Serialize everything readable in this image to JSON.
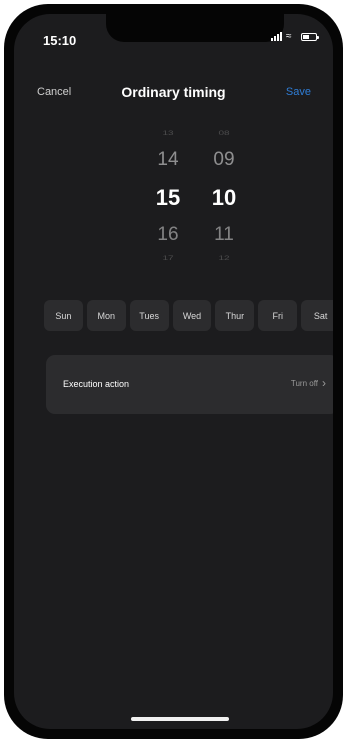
{
  "status_bar": {
    "time": "15:10"
  },
  "header": {
    "cancel": "Cancel",
    "title": "Ordinary timing",
    "save": "Save"
  },
  "picker": {
    "hours": [
      "13",
      "14",
      "15",
      "16",
      "17"
    ],
    "minutes": [
      "08",
      "09",
      "10",
      "11",
      "12"
    ],
    "selected_hour": "15",
    "selected_minute": "10"
  },
  "days": [
    "Sun",
    "Mon",
    "Tues",
    "Wed",
    "Thur",
    "Fri",
    "Sat"
  ],
  "action": {
    "label": "Execution action",
    "value": "Turn off"
  },
  "colors": {
    "accent": "#2f7dd6",
    "background": "#1c1c1e",
    "surface": "#2c2c2e"
  },
  "icons": [
    "signal-icon",
    "wifi-icon",
    "battery-icon",
    "chevron-right-icon"
  ]
}
